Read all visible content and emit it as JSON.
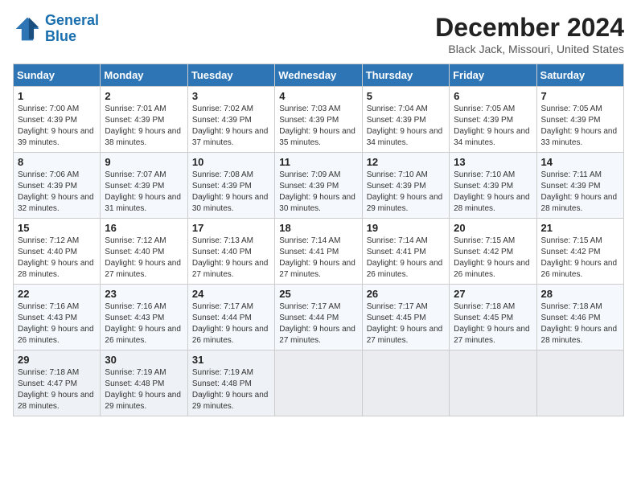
{
  "logo": {
    "line1": "General",
    "line2": "Blue"
  },
  "title": "December 2024",
  "location": "Black Jack, Missouri, United States",
  "weekdays": [
    "Sunday",
    "Monday",
    "Tuesday",
    "Wednesday",
    "Thursday",
    "Friday",
    "Saturday"
  ],
  "weeks": [
    [
      {
        "day": "1",
        "sunrise": "7:00 AM",
        "sunset": "4:39 PM",
        "daylight": "9 hours and 39 minutes."
      },
      {
        "day": "2",
        "sunrise": "7:01 AM",
        "sunset": "4:39 PM",
        "daylight": "9 hours and 38 minutes."
      },
      {
        "day": "3",
        "sunrise": "7:02 AM",
        "sunset": "4:39 PM",
        "daylight": "9 hours and 37 minutes."
      },
      {
        "day": "4",
        "sunrise": "7:03 AM",
        "sunset": "4:39 PM",
        "daylight": "9 hours and 35 minutes."
      },
      {
        "day": "5",
        "sunrise": "7:04 AM",
        "sunset": "4:39 PM",
        "daylight": "9 hours and 34 minutes."
      },
      {
        "day": "6",
        "sunrise": "7:05 AM",
        "sunset": "4:39 PM",
        "daylight": "9 hours and 34 minutes."
      },
      {
        "day": "7",
        "sunrise": "7:05 AM",
        "sunset": "4:39 PM",
        "daylight": "9 hours and 33 minutes."
      }
    ],
    [
      {
        "day": "8",
        "sunrise": "7:06 AM",
        "sunset": "4:39 PM",
        "daylight": "9 hours and 32 minutes."
      },
      {
        "day": "9",
        "sunrise": "7:07 AM",
        "sunset": "4:39 PM",
        "daylight": "9 hours and 31 minutes."
      },
      {
        "day": "10",
        "sunrise": "7:08 AM",
        "sunset": "4:39 PM",
        "daylight": "9 hours and 30 minutes."
      },
      {
        "day": "11",
        "sunrise": "7:09 AM",
        "sunset": "4:39 PM",
        "daylight": "9 hours and 30 minutes."
      },
      {
        "day": "12",
        "sunrise": "7:10 AM",
        "sunset": "4:39 PM",
        "daylight": "9 hours and 29 minutes."
      },
      {
        "day": "13",
        "sunrise": "7:10 AM",
        "sunset": "4:39 PM",
        "daylight": "9 hours and 28 minutes."
      },
      {
        "day": "14",
        "sunrise": "7:11 AM",
        "sunset": "4:39 PM",
        "daylight": "9 hours and 28 minutes."
      }
    ],
    [
      {
        "day": "15",
        "sunrise": "7:12 AM",
        "sunset": "4:40 PM",
        "daylight": "9 hours and 28 minutes."
      },
      {
        "day": "16",
        "sunrise": "7:12 AM",
        "sunset": "4:40 PM",
        "daylight": "9 hours and 27 minutes."
      },
      {
        "day": "17",
        "sunrise": "7:13 AM",
        "sunset": "4:40 PM",
        "daylight": "9 hours and 27 minutes."
      },
      {
        "day": "18",
        "sunrise": "7:14 AM",
        "sunset": "4:41 PM",
        "daylight": "9 hours and 27 minutes."
      },
      {
        "day": "19",
        "sunrise": "7:14 AM",
        "sunset": "4:41 PM",
        "daylight": "9 hours and 26 minutes."
      },
      {
        "day": "20",
        "sunrise": "7:15 AM",
        "sunset": "4:42 PM",
        "daylight": "9 hours and 26 minutes."
      },
      {
        "day": "21",
        "sunrise": "7:15 AM",
        "sunset": "4:42 PM",
        "daylight": "9 hours and 26 minutes."
      }
    ],
    [
      {
        "day": "22",
        "sunrise": "7:16 AM",
        "sunset": "4:43 PM",
        "daylight": "9 hours and 26 minutes."
      },
      {
        "day": "23",
        "sunrise": "7:16 AM",
        "sunset": "4:43 PM",
        "daylight": "9 hours and 26 minutes."
      },
      {
        "day": "24",
        "sunrise": "7:17 AM",
        "sunset": "4:44 PM",
        "daylight": "9 hours and 26 minutes."
      },
      {
        "day": "25",
        "sunrise": "7:17 AM",
        "sunset": "4:44 PM",
        "daylight": "9 hours and 27 minutes."
      },
      {
        "day": "26",
        "sunrise": "7:17 AM",
        "sunset": "4:45 PM",
        "daylight": "9 hours and 27 minutes."
      },
      {
        "day": "27",
        "sunrise": "7:18 AM",
        "sunset": "4:45 PM",
        "daylight": "9 hours and 27 minutes."
      },
      {
        "day": "28",
        "sunrise": "7:18 AM",
        "sunset": "4:46 PM",
        "daylight": "9 hours and 28 minutes."
      }
    ],
    [
      {
        "day": "29",
        "sunrise": "7:18 AM",
        "sunset": "4:47 PM",
        "daylight": "9 hours and 28 minutes."
      },
      {
        "day": "30",
        "sunrise": "7:19 AM",
        "sunset": "4:48 PM",
        "daylight": "9 hours and 29 minutes."
      },
      {
        "day": "31",
        "sunrise": "7:19 AM",
        "sunset": "4:48 PM",
        "daylight": "9 hours and 29 minutes."
      },
      null,
      null,
      null,
      null
    ]
  ]
}
